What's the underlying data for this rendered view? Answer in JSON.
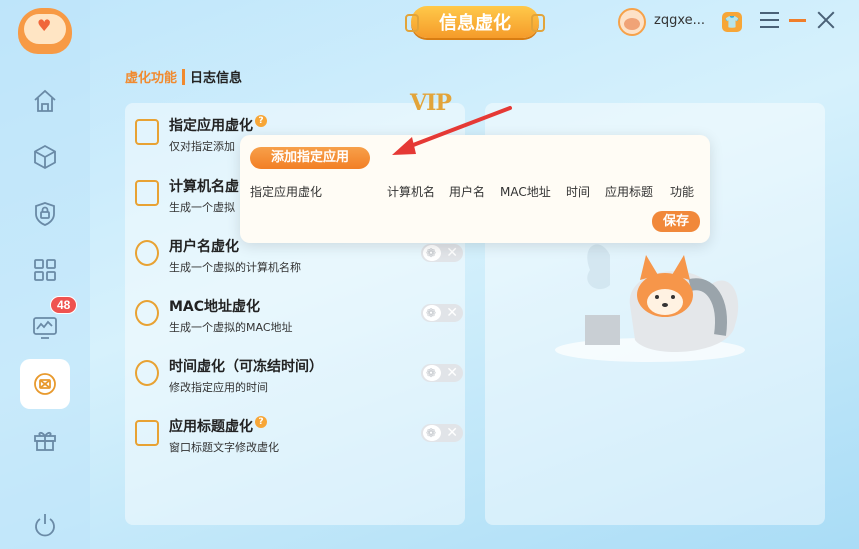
{
  "header": {
    "title": "信息虚化",
    "username": "zqgxe...",
    "shirt_icon": "shirt-icon"
  },
  "sidebar": {
    "items": [
      {
        "icon": "home-icon"
      },
      {
        "icon": "cube-icon"
      },
      {
        "icon": "lock-icon"
      },
      {
        "icon": "apps-grid-icon"
      },
      {
        "icon": "monitor-chart-icon",
        "badge": "48"
      },
      {
        "icon": "info-virtualize-icon",
        "active": true
      },
      {
        "icon": "gift-icon"
      },
      {
        "icon": "power-icon"
      }
    ]
  },
  "tabs": {
    "active": "虚化功能",
    "other": "日志信息"
  },
  "vip_label": "VIP",
  "features": [
    {
      "name": "指定应用虚化",
      "desc": "仅对指定添加",
      "help": "?"
    },
    {
      "name": "计算机名虚",
      "desc": "生成一个虚拟"
    },
    {
      "name": "用户名虚化",
      "desc": "生成一个虚拟的计算机名称"
    },
    {
      "name": "MAC地址虚化",
      "desc": "生成一个虚拟的MAC地址"
    },
    {
      "name": "时间虚化（可冻结时间）",
      "desc": "修改指定应用的时间"
    },
    {
      "name": "应用标题虚化",
      "desc": "窗口标题文字修改虚化",
      "help": "?"
    }
  ],
  "popup": {
    "add_button": "添加指定应用",
    "columns": [
      "指定应用虚化",
      "计算机名",
      "用户名",
      "MAC地址",
      "时间",
      "应用标题",
      "功能"
    ],
    "save_button": "保存"
  },
  "colors": {
    "accent": "#f18a2e",
    "arrow": "#e53935",
    "background": "#c7eafb"
  }
}
